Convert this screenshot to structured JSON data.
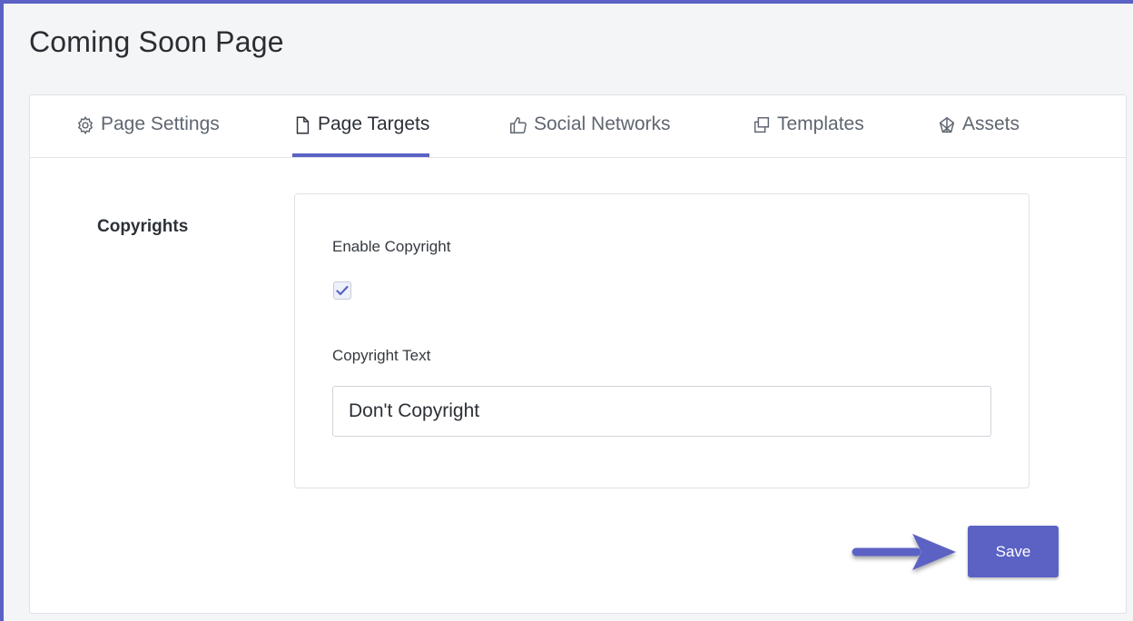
{
  "page": {
    "title": "Coming Soon Page"
  },
  "tabs": [
    {
      "label": "Page Settings",
      "icon": "gear-icon",
      "active": false
    },
    {
      "label": "Page Targets",
      "icon": "document-icon",
      "active": true
    },
    {
      "label": "Social Networks",
      "icon": "thumbs-up-icon",
      "active": false
    },
    {
      "label": "Templates",
      "icon": "duplicate-icon",
      "active": false
    },
    {
      "label": "Assets",
      "icon": "assets-icon",
      "active": false
    }
  ],
  "section": {
    "label": "Copyrights"
  },
  "form": {
    "enable_label": "Enable Copyright",
    "enable_checked": true,
    "text_label": "Copyright Text",
    "text_value": "Don't Copyright"
  },
  "actions": {
    "save_label": "Save"
  },
  "colors": {
    "accent": "#5b62c4"
  }
}
